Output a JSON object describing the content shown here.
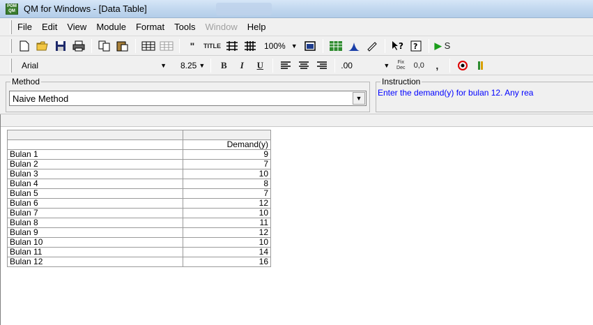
{
  "window": {
    "title": "QM for Windows - [Data Table]",
    "app_icon_text": "POM QM"
  },
  "menu": {
    "items": [
      {
        "label": "File",
        "enabled": true
      },
      {
        "label": "Edit",
        "enabled": true
      },
      {
        "label": "View",
        "enabled": true
      },
      {
        "label": "Module",
        "enabled": true
      },
      {
        "label": "Format",
        "enabled": true
      },
      {
        "label": "Tools",
        "enabled": true
      },
      {
        "label": "Window",
        "enabled": false
      },
      {
        "label": "Help",
        "enabled": true
      }
    ]
  },
  "toolbar1": {
    "zoom": "100%",
    "title_btn": "TITLE",
    "solve_label": "S"
  },
  "toolbar2": {
    "font_name": "Arial",
    "font_size": "8.25",
    "bold": "B",
    "italic": "I",
    "underline": "U",
    "decimal": ".00",
    "fix_dec": "Fix Dec",
    "format_00": "0,0",
    "comma": ","
  },
  "method_panel": {
    "legend": "Method",
    "selected": "Naive Method"
  },
  "instruction_panel": {
    "legend": "Instruction",
    "text": "Enter the demand(y) for bulan 12. Any rea"
  },
  "table": {
    "columns": [
      "",
      "Demand(y)"
    ],
    "rows": [
      {
        "name": "Bulan 1",
        "demand": "9"
      },
      {
        "name": "Bulan 2",
        "demand": "7"
      },
      {
        "name": "Bulan 3",
        "demand": "10"
      },
      {
        "name": "Bulan 4",
        "demand": "8"
      },
      {
        "name": "Bulan 5",
        "demand": "7"
      },
      {
        "name": "Bulan 6",
        "demand": "12"
      },
      {
        "name": "Bulan 7",
        "demand": "10"
      },
      {
        "name": "Bulan 8",
        "demand": "11"
      },
      {
        "name": "Bulan 9",
        "demand": "12"
      },
      {
        "name": "Bulan 10",
        "demand": "10"
      },
      {
        "name": "Bulan 11",
        "demand": "14"
      },
      {
        "name": "Bulan 12",
        "demand": "16"
      }
    ]
  },
  "colors": {
    "instruction_text": "#0000ff",
    "solve_green": "#1a9d1a"
  }
}
